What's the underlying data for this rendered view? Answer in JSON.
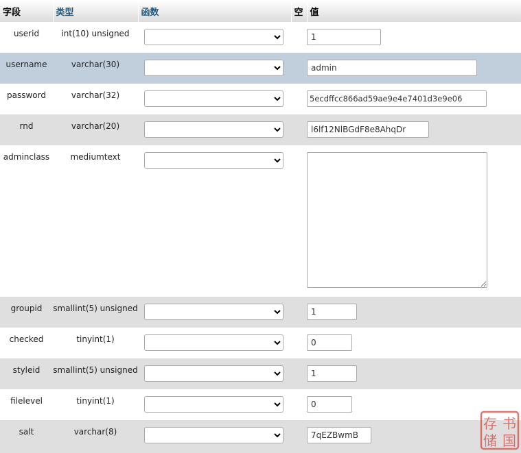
{
  "header": {
    "field": "字段",
    "type": "类型",
    "function": "函数",
    "null": "空",
    "value": "值"
  },
  "rows": [
    {
      "field": "userid",
      "type": "int(10) unsigned",
      "value": "1"
    },
    {
      "field": "username",
      "type": "varchar(30)",
      "value": "admin"
    },
    {
      "field": "password",
      "type": "varchar(32)",
      "value": "5ecdffcc866ad59ae9e4e7401d3e9e06"
    },
    {
      "field": "rnd",
      "type": "varchar(20)",
      "value": "l6lf12NlBGdF8e8AhqDr"
    },
    {
      "field": "adminclass",
      "type": "mediumtext",
      "value": ""
    },
    {
      "field": "groupid",
      "type": "smallint(5) unsigned",
      "value": "1"
    },
    {
      "field": "checked",
      "type": "tinyint(1)",
      "value": "0"
    },
    {
      "field": "styleid",
      "type": "smallint(5) unsigned",
      "value": "1"
    },
    {
      "field": "filelevel",
      "type": "tinyint(1)",
      "value": "0"
    },
    {
      "field": "salt",
      "type": "varchar(8)",
      "value": "7qEZBwmB"
    }
  ],
  "seal": {
    "text": "书国存储",
    "color": "#d9534f"
  },
  "icons": {
    "select_arrow": "chevron-down-icon",
    "resize": "resize-handle-icon"
  }
}
